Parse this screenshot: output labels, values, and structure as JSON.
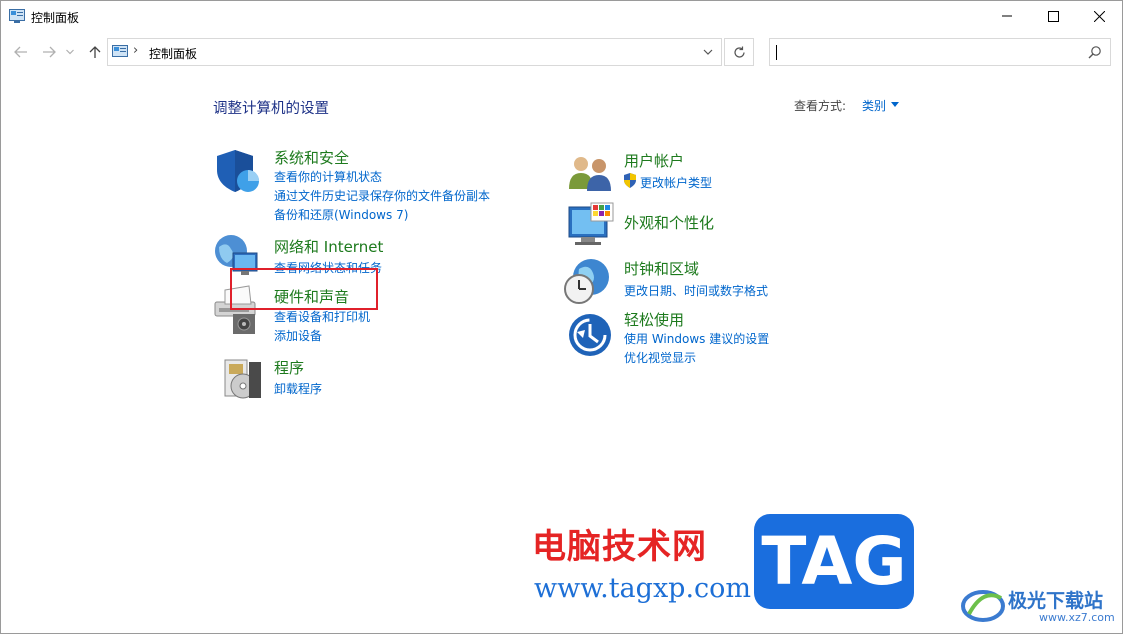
{
  "window": {
    "title": "控制面板",
    "buttons": [
      "minimize",
      "maximize",
      "close"
    ]
  },
  "address": {
    "path": "控制面板",
    "search_placeholder": ""
  },
  "header": {
    "title": "调整计算机的设置",
    "view_label": "查看方式:",
    "view_value": "类别"
  },
  "categories": {
    "system": {
      "title": "系统和安全",
      "links": [
        "查看你的计算机状态",
        "通过文件历史记录保存你的文件备份副本",
        "备份和还原(Windows 7)"
      ]
    },
    "network": {
      "title": "网络和 Internet",
      "links": [
        "查看网络状态和任务"
      ]
    },
    "hardware": {
      "title": "硬件和声音",
      "links": [
        "查看设备和打印机",
        "添加设备"
      ]
    },
    "programs": {
      "title": "程序",
      "links": [
        "卸载程序"
      ]
    },
    "users": {
      "title": "用户帐户",
      "links": [
        "更改帐户类型"
      ]
    },
    "appearance": {
      "title": "外观和个性化",
      "links": []
    },
    "clock": {
      "title": "时钟和区域",
      "links": [
        "更改日期、时间或数字格式"
      ]
    },
    "ease": {
      "title": "轻松使用",
      "links": [
        "使用 Windows 建议的设置",
        "优化视觉显示"
      ]
    }
  },
  "watermark": {
    "cn": "电脑技术网",
    "url": "www.tagxp.com",
    "tag": "TAG",
    "site_cn": "极光下载站",
    "site_url": "www.xz7.com"
  },
  "colors": {
    "title_blue": "#1e3287",
    "link_blue": "#0066cc",
    "category_green": "#1d7a1d",
    "highlight_red": "#e0202b"
  }
}
